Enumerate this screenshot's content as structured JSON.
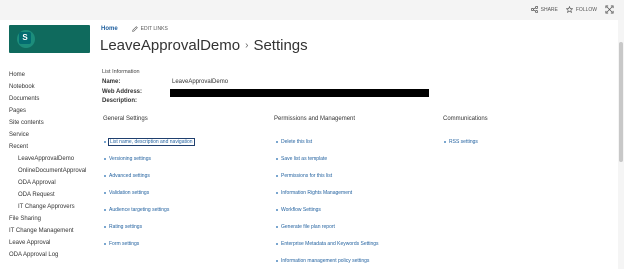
{
  "topbar": {
    "share_label": "SHARE",
    "follow_label": "FOLLOW",
    "icons": [
      "share-icon",
      "star-icon",
      "focus-icon"
    ]
  },
  "breadcrumb": {
    "home": "Home",
    "edit_links": "EDIT LINKS"
  },
  "title": {
    "site": "LeaveApprovalDemo",
    "separator": "›",
    "page": "Settings"
  },
  "nav": {
    "items": [
      {
        "label": "Home"
      },
      {
        "label": "Notebook"
      },
      {
        "label": "Documents"
      },
      {
        "label": "Pages"
      },
      {
        "label": "Site contents"
      },
      {
        "label": "Service"
      },
      {
        "label": "Recent"
      },
      {
        "label": "LeaveApprovalDemo"
      },
      {
        "label": "OnlineDocumentApproval"
      },
      {
        "label": "ODA Approval"
      },
      {
        "label": "ODA Request"
      },
      {
        "label": "IT Change Approvers"
      },
      {
        "label": "File Sharing"
      },
      {
        "label": "IT Change Management"
      },
      {
        "label": "Leave Approval"
      },
      {
        "label": "ODA Approval Log"
      }
    ]
  },
  "list_info": {
    "heading": "List Information",
    "name_label": "Name:",
    "name_value": "LeaveApprovalDemo",
    "web_address_label": "Web Address:",
    "description_label": "Description:"
  },
  "columns": {
    "general": {
      "heading": "General Settings",
      "links": [
        "List name, description and navigation",
        "Versioning settings",
        "Advanced settings",
        "Validation settings",
        "Audience targeting settings",
        "Rating settings",
        "Form settings"
      ]
    },
    "permissions": {
      "heading": "Permissions and Management",
      "links": [
        "Delete this list",
        "Save list as template",
        "Permissions for this list",
        "Information Rights Management",
        "Workflow Settings",
        "Generate file plan report",
        "Enterprise Metadata and Keywords Settings",
        "Information management policy settings"
      ]
    },
    "communications": {
      "heading": "Communications",
      "links": [
        "RSS settings"
      ]
    }
  },
  "colors": {
    "accent_link": "#1f5f9e",
    "logo_bg": "#0f6a5d",
    "topbar_bg": "#f4f4f4"
  }
}
